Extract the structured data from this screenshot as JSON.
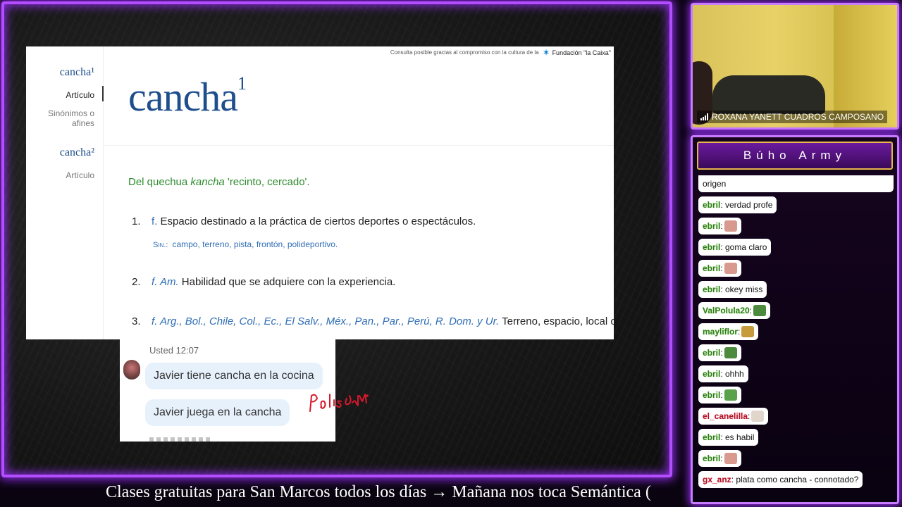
{
  "colors": {
    "frame": "#b44dff",
    "dict_blue": "#1e4e8c",
    "etym_green": "#2e8b2e",
    "link_blue": "#2f6db5"
  },
  "dictionary": {
    "credit_text": "Consulta posible gracias al compromiso con la cultura de la",
    "credit_brand": "Fundación \"la Caixa\"",
    "sidebar": {
      "entry1": "cancha¹",
      "entry1_article": "Artículo",
      "entry1_synonyms": "Sinónimos o afines",
      "entry2": "cancha²",
      "entry2_article": "Artículo"
    },
    "headword": "cancha",
    "headword_sup": "1",
    "etymology_prefix": "Del quechua ",
    "etymology_word": "kancha",
    "etymology_suffix": " 'recinto, cercado'.",
    "senses": [
      {
        "num": "1.",
        "abbr": "f.",
        "text": " Espacio destinado a la práctica de ciertos deportes o espectáculos."
      },
      {
        "num": "2.",
        "abbr": "f. Am.",
        "text": " Habilidad que se adquiere con la experiencia."
      },
      {
        "num": "3.",
        "abbr": "f. Arg., Bol., Chile, Col., Ec., El Salv., Méx., Pan., Par., Perú, R. Dom. y Ur.",
        "text": " Terreno, espacio, local o sitio llano y"
      }
    ],
    "synonyms_label": "Sin.:",
    "synonyms": "campo, terreno, pista, frontón, polideportivo."
  },
  "whatsapp": {
    "time": "Usted 12:07",
    "bubble1": "Javier tiene cancha en la cocina",
    "bubble2": "Javier juega en la cancha"
  },
  "scribble": "Polisemia",
  "ticker": "Clases gratuitas para San Marcos todos los días  →  Mañana nos toca Semántica (",
  "webcam": {
    "name": "ROXANA YANETT CUADROS CAMPOSANO"
  },
  "chat": {
    "title": "Búho Army",
    "messages": [
      {
        "user": "",
        "text": "origen",
        "emote": ""
      },
      {
        "user": "ebril",
        "text": ": verdad profe",
        "emote": ""
      },
      {
        "user": "ebril",
        "text": ":",
        "emote": "pig-emote"
      },
      {
        "user": "ebril",
        "text": ": goma claro",
        "emote": ""
      },
      {
        "user": "ebril",
        "text": ":",
        "emote": "pig-emote"
      },
      {
        "user": "ebril",
        "text": ": okey miss",
        "emote": ""
      },
      {
        "user": "ValPolula20",
        "text": ":",
        "emote": "frog-emote"
      },
      {
        "user": "mayliflor",
        "text": ":",
        "emote": "dog-emote"
      },
      {
        "user": "ebril",
        "text": ":",
        "emote": "frog-emote"
      },
      {
        "user": "ebril",
        "text": ": ohhh",
        "emote": ""
      },
      {
        "user": "ebril",
        "text": ":",
        "emote": "frog-small-emote"
      },
      {
        "user": "el_canelilla",
        "text": ":",
        "emote": "cat-emote"
      },
      {
        "user": "ebril",
        "text": ": es habil",
        "emote": ""
      },
      {
        "user": "ebril",
        "text": ":",
        "emote": "pig-emote"
      },
      {
        "user": "gx_anz",
        "text": ": plata como cancha - connotado?",
        "emote": ""
      }
    ]
  }
}
